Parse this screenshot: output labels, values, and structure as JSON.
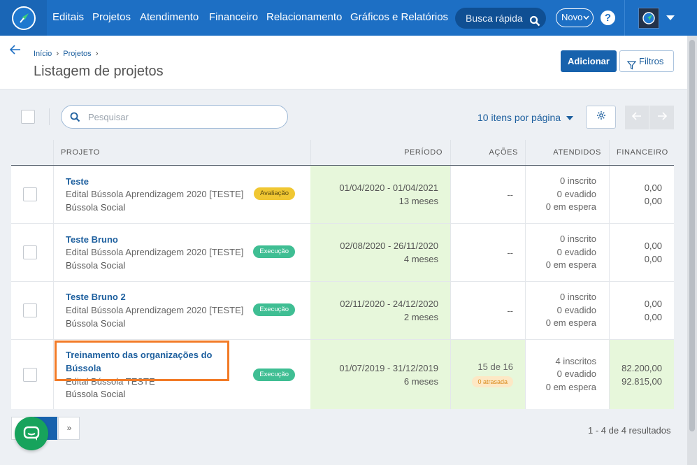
{
  "nav": {
    "items": [
      "Editais",
      "Projetos",
      "Atendimento",
      "Financeiro",
      "Relacionamento",
      "Gráficos e Relatórios"
    ],
    "search_label": "Busca rápida",
    "new_label": "Novo",
    "help_label": "?"
  },
  "header": {
    "breadcrumb": [
      "Início",
      "Projetos"
    ],
    "title": "Listagem de projetos",
    "add_label": "Adicionar",
    "filter_label": "Filtros"
  },
  "toolbar": {
    "search_placeholder": "Pesquisar",
    "per_page_label": "10 itens por página"
  },
  "table": {
    "columns": [
      "PROJETO",
      "PERÍODO",
      "AÇÕES",
      "ATENDIDOS",
      "FINANCEIRO"
    ],
    "rows": [
      {
        "name": "Teste",
        "edital": "Edital Bússola Aprendizagem 2020 [TESTE]",
        "org": "Bússola Social",
        "status": "Avaliação",
        "period": "01/04/2020 - 01/04/2021",
        "duration": "13 meses",
        "acoes": "--",
        "inscritos": "0 inscrito",
        "evadidos": "0 evadido",
        "espera": "0 em espera",
        "fin1": "0,00",
        "fin2": "0,00"
      },
      {
        "name": "Teste Bruno",
        "edital": "Edital Bússola Aprendizagem 2020 [TESTE]",
        "org": "Bússola Social",
        "status": "Execução",
        "period": "02/08/2020 - 26/11/2020",
        "duration": "4 meses",
        "acoes": "--",
        "inscritos": "0 inscrito",
        "evadidos": "0 evadido",
        "espera": "0 em espera",
        "fin1": "0,00",
        "fin2": "0,00"
      },
      {
        "name": "Teste Bruno 2",
        "edital": "Edital Bússola Aprendizagem 2020 [TESTE]",
        "org": "Bússola Social",
        "status": "Execução",
        "period": "02/11/2020 - 24/12/2020",
        "duration": "2 meses",
        "acoes": "--",
        "inscritos": "0 inscrito",
        "evadidos": "0 evadido",
        "espera": "0 em espera",
        "fin1": "0,00",
        "fin2": "0,00"
      },
      {
        "name_line1": "Treinamento das organizações do",
        "name_line2": "Bússola",
        "edital": "Edital Bússola TESTE",
        "org": "Bússola Social",
        "status": "Execução",
        "period": "01/07/2019 - 31/12/2019",
        "duration": "6 meses",
        "acoes": "15 de 16",
        "acoes_late": "0 atrasada",
        "inscritos": "4 inscritos",
        "evadidos": "0 evadido",
        "espera": "0 em espera",
        "fin1": "82.200,00",
        "fin2": "92.815,00"
      }
    ]
  },
  "footer": {
    "next_label": "»",
    "results": "1 - 4 de 4 resultados"
  },
  "colors": {
    "nav_bg": "#1d6fc4",
    "primary": "#1762ad",
    "period_bg": "#e7f7db",
    "badge_eval": "#f0c732",
    "badge_exec": "#3fbe93",
    "highlight": "#f27b27",
    "chat": "#17a35c"
  },
  "icons": {
    "logo": "compass-logo-icon",
    "search": "search-icon",
    "help": "help-icon",
    "filter": "filter-icon",
    "gear": "gear-icon",
    "chat": "chat-icon",
    "back": "arrow-left-icon"
  }
}
